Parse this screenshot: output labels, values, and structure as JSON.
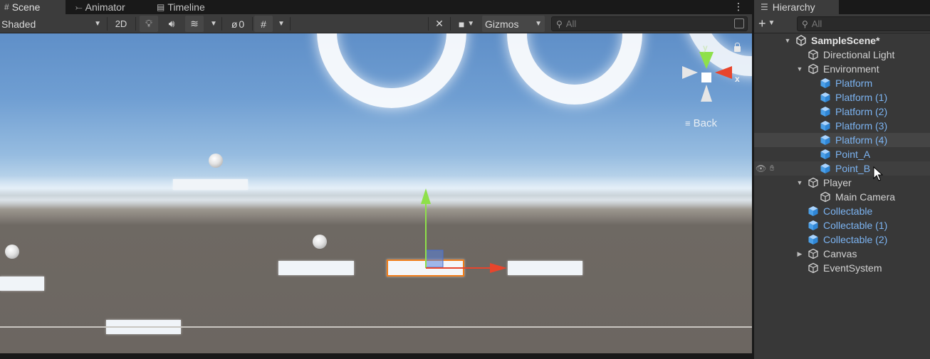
{
  "scene_tabs": [
    {
      "label": "Scene",
      "icon": "grid-icon"
    },
    {
      "label": "Animator",
      "icon": "animator-icon"
    },
    {
      "label": "Timeline",
      "icon": "timeline-icon"
    }
  ],
  "scene_toolbar": {
    "draw_mode": "Shaded",
    "toggle_2d": "2D",
    "hidden_count": "0",
    "gizmos_label": "Gizmos",
    "search_placeholder": "All"
  },
  "viewport": {
    "back_label": "Back",
    "axis_x": "x",
    "axis_y": "y"
  },
  "hierarchy": {
    "tab_label": "Hierarchy",
    "search_placeholder": "All",
    "scene_name": "SampleScene*",
    "items": [
      {
        "label": "Directional Light",
        "type": "gameobject",
        "depth": 1
      },
      {
        "label": "Environment",
        "type": "gameobject",
        "depth": 1,
        "expanded": true
      },
      {
        "label": "Platform",
        "type": "prefab",
        "depth": 2
      },
      {
        "label": "Platform (1)",
        "type": "prefab",
        "depth": 2
      },
      {
        "label": "Platform (2)",
        "type": "prefab",
        "depth": 2
      },
      {
        "label": "Platform (3)",
        "type": "prefab",
        "depth": 2
      },
      {
        "label": "Platform (4)",
        "type": "prefab",
        "depth": 2,
        "selected": true
      },
      {
        "label": "Point_A",
        "type": "prefab",
        "depth": 2
      },
      {
        "label": "Point_B",
        "type": "prefab",
        "depth": 2,
        "hovered": true
      },
      {
        "label": "Player",
        "type": "gameobject",
        "depth": 1,
        "expanded": true
      },
      {
        "label": "Main Camera",
        "type": "gameobject",
        "depth": 2
      },
      {
        "label": "Collectable",
        "type": "prefab",
        "depth": 1
      },
      {
        "label": "Collectable (1)",
        "type": "prefab",
        "depth": 1
      },
      {
        "label": "Collectable (2)",
        "type": "prefab",
        "depth": 1
      },
      {
        "label": "Canvas",
        "type": "gameobject",
        "depth": 1,
        "collapsed": true
      },
      {
        "label": "EventSystem",
        "type": "gameobject",
        "depth": 1
      }
    ]
  },
  "colors": {
    "prefab_text": "#7cb4f2",
    "selection_outline": "#f07c18",
    "axis_x": "#e8452c",
    "axis_y": "#8ee04a"
  }
}
